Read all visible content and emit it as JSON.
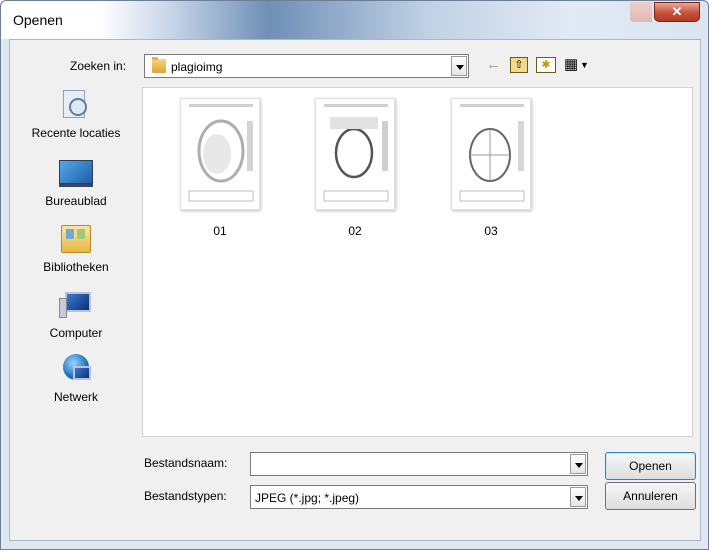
{
  "window": {
    "title": "Openen",
    "close_glyph": "✕"
  },
  "lookin": {
    "label": "Zoeken in:",
    "value": "plagioimg"
  },
  "toolbar": {
    "back_icon": "←",
    "up_folder_icon": "⇧",
    "new_folder_icon": "✱",
    "view_menu_icon": "▦"
  },
  "places": [
    {
      "label": "Recente locaties",
      "icon": "recent-locations-icon"
    },
    {
      "label": "Bureaublad",
      "icon": "desktop-icon"
    },
    {
      "label": "Bibliotheken",
      "icon": "libraries-icon"
    },
    {
      "label": "Computer",
      "icon": "computer-icon"
    },
    {
      "label": "Netwerk",
      "icon": "network-icon"
    }
  ],
  "files": [
    {
      "name": "01"
    },
    {
      "name": "02"
    },
    {
      "name": "03"
    }
  ],
  "filename": {
    "label": "Bestandsnaam:",
    "value": ""
  },
  "filetype": {
    "label": "Bestandstypen:",
    "value": "JPEG (*.jpg; *.jpeg)"
  },
  "buttons": {
    "open": "Openen",
    "cancel": "Annuleren"
  },
  "colors": {
    "accent": "#3c7fb1",
    "close": "#c7513b"
  }
}
